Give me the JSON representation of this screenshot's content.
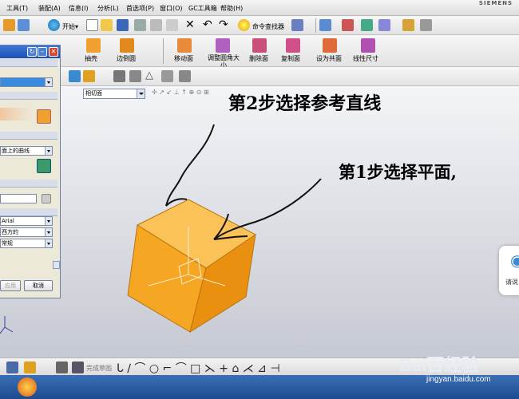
{
  "menu": {
    "items": [
      "工具(T)",
      "装配(A)",
      "信息(I)",
      "分析(L)",
      "首选项(P)",
      "窗口(O)",
      "GC工具箱",
      "帮助(H)"
    ],
    "brand": "SIEMENS"
  },
  "toolbar1": {
    "start_label": "开始▾",
    "command_finder": "命令查找器"
  },
  "toolbar2": {
    "buttons": [
      "抽壳",
      "边倒圆",
      "移动面",
      "调整圆角大小",
      "删除面",
      "复制面",
      "设为共面",
      "线性尺寸"
    ]
  },
  "toolbar3": {
    "filter_value": "相切面"
  },
  "dialog": {
    "curve_option": "面上的曲线",
    "font": "Arial",
    "direction": "西方的",
    "style": "常规",
    "apply_label": "应用",
    "cancel_label": "取消"
  },
  "bottom_toolbar": {
    "sketch_label": "完成草图"
  },
  "annotations": {
    "step2": "第2步选择参考直线",
    "step1": "第1步选择平面,"
  },
  "voice_widget": {
    "label": "请说"
  },
  "watermark": {
    "brand": "Bai百经验",
    "url": "jingyan.baidu.com"
  },
  "colors": {
    "cube": "#f5a623",
    "title_bar": "#1c4fb4",
    "taskbar": "#2a5ba0"
  }
}
